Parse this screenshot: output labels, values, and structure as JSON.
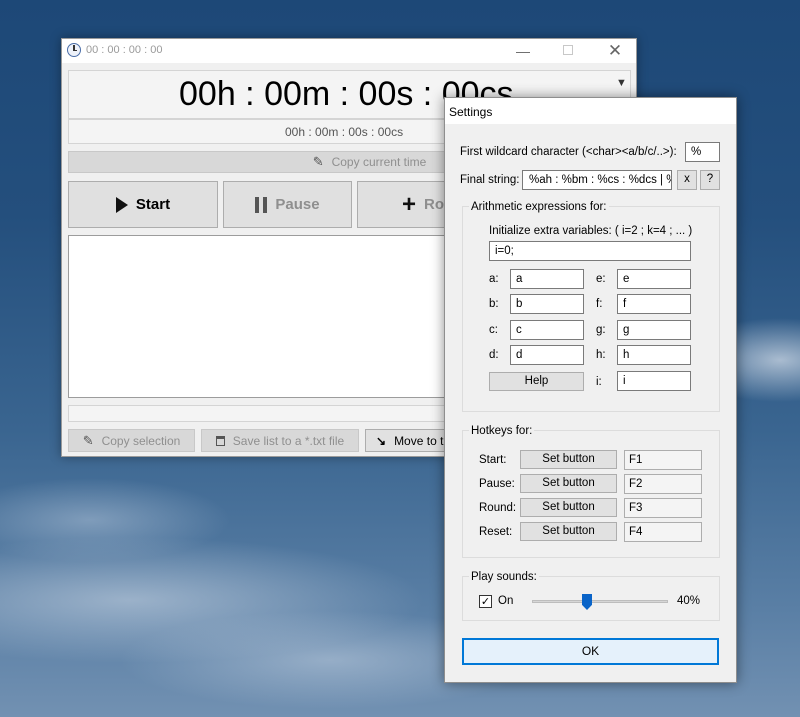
{
  "main": {
    "title": "00 : 00 : 00 : 00",
    "big_time": "00h : 00m : 00s : 00cs",
    "small_time": "00h : 00m : 00s : 00cs",
    "copy_current_label": "Copy current time",
    "start_label": "Start",
    "pause_label": "Pause",
    "round_label": "Ro",
    "copy_selection_label": "Copy selection",
    "save_list_label": "Save list to a *.txt file",
    "move_label": "Move to th"
  },
  "settings": {
    "title": "Settings",
    "wildcard_label": "First wildcard character (<char><a/b/c/..>):",
    "wildcard_value": "%",
    "final_string_label": "Final string:",
    "final_string_value": "%ah : %bm : %cs : %dcs | %",
    "x_label": "x",
    "question_label": "?",
    "arith_group_label": "Arithmetic expressions for:",
    "init_label": "Initialize extra variables: ( i=2 ; k=4 ; ... )",
    "init_value": "i=0;",
    "vars": [
      {
        "label": "a:",
        "value": "a"
      },
      {
        "label": "b:",
        "value": "b"
      },
      {
        "label": "c:",
        "value": "c"
      },
      {
        "label": "d:",
        "value": "d"
      },
      {
        "label": "e:",
        "value": "e"
      },
      {
        "label": "f:",
        "value": "f"
      },
      {
        "label": "g:",
        "value": "g"
      },
      {
        "label": "h:",
        "value": "h"
      },
      {
        "label": "i:",
        "value": "i"
      }
    ],
    "help_label": "Help",
    "hotkeys_group_label": "Hotkeys for:",
    "hotkeys": [
      {
        "label": "Start:",
        "button": "Set button",
        "key": "F1"
      },
      {
        "label": "Pause:",
        "button": "Set button",
        "key": "F2"
      },
      {
        "label": "Round:",
        "button": "Set button",
        "key": "F3"
      },
      {
        "label": "Reset:",
        "button": "Set button",
        "key": "F4"
      }
    ],
    "sounds_group_label": "Play sounds:",
    "sound_on_label": "On",
    "volume_percent_label": "40%",
    "volume": 0.4,
    "ok_label": "OK"
  }
}
